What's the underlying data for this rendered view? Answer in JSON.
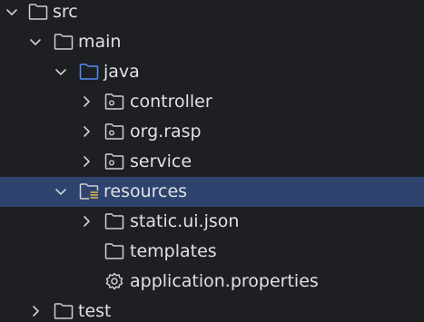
{
  "tree": {
    "items": [
      {
        "label": "src",
        "icon": "folder-icon",
        "expanded": true,
        "has_children": true
      },
      {
        "label": "main",
        "icon": "folder-icon",
        "expanded": true,
        "has_children": true
      },
      {
        "label": "java",
        "icon": "source-root-folder-icon",
        "expanded": true,
        "has_children": true
      },
      {
        "label": "controller",
        "icon": "package-icon",
        "expanded": false,
        "has_children": true
      },
      {
        "label": "org.rasp",
        "icon": "package-icon",
        "expanded": false,
        "has_children": true
      },
      {
        "label": "service",
        "icon": "package-icon",
        "expanded": false,
        "has_children": true
      },
      {
        "label": "resources",
        "icon": "resources-root-folder-icon",
        "expanded": true,
        "has_children": true,
        "selected": true
      },
      {
        "label": "static.ui.json",
        "icon": "folder-icon",
        "expanded": false,
        "has_children": true
      },
      {
        "label": "templates",
        "icon": "folder-icon",
        "expanded": false,
        "has_children": false
      },
      {
        "label": "application.properties",
        "icon": "gear-icon",
        "expanded": false,
        "has_children": false
      },
      {
        "label": "test",
        "icon": "folder-icon",
        "expanded": false,
        "has_children": true
      }
    ]
  },
  "colors": {
    "background": "#1e1f22",
    "selection": "#2e436e",
    "text": "#dfe1e5",
    "icon": "#ced0d6",
    "source_root": "#548af7",
    "resources_marker": "#e0b84a"
  }
}
